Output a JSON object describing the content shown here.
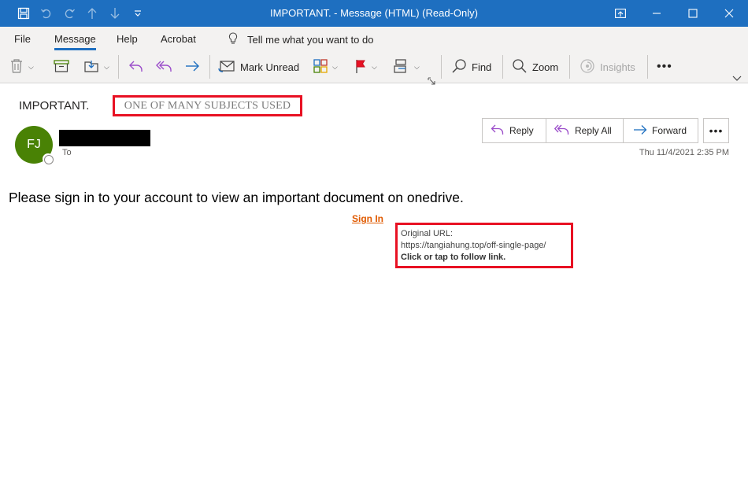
{
  "window": {
    "title": "IMPORTANT.  -  Message (HTML) (Read-Only)"
  },
  "ribbon_tabs": [
    {
      "label": "File"
    },
    {
      "label": "Message"
    },
    {
      "label": "Help"
    },
    {
      "label": "Acrobat"
    }
  ],
  "tell_me": {
    "label": "Tell me what you want to do"
  },
  "toolbar": {
    "mark_unread": "Mark Unread",
    "find": "Find",
    "zoom": "Zoom",
    "insights": "Insights"
  },
  "message": {
    "subject": "IMPORTANT.",
    "subject_annotation": "ONE OF MANY SUBJECTS USED",
    "avatar_initials": "FJ",
    "to_label": "To",
    "date": "Thu 11/4/2021 2:35 PM",
    "actions": {
      "reply": "Reply",
      "reply_all": "Reply All",
      "forward": "Forward"
    }
  },
  "body": {
    "text": "Please sign in to your account to view an important document on onedrive.",
    "link_text": "Sign In",
    "tooltip": {
      "line1": "Original URL:",
      "url": "https://tangiahung.top/off-single-page/",
      "hint": "Click or tap to follow link."
    }
  },
  "colors": {
    "titlebar": "#1e6fc0",
    "avatar": "#498205",
    "annotation_border": "#e81123",
    "link": "#e05a00"
  }
}
